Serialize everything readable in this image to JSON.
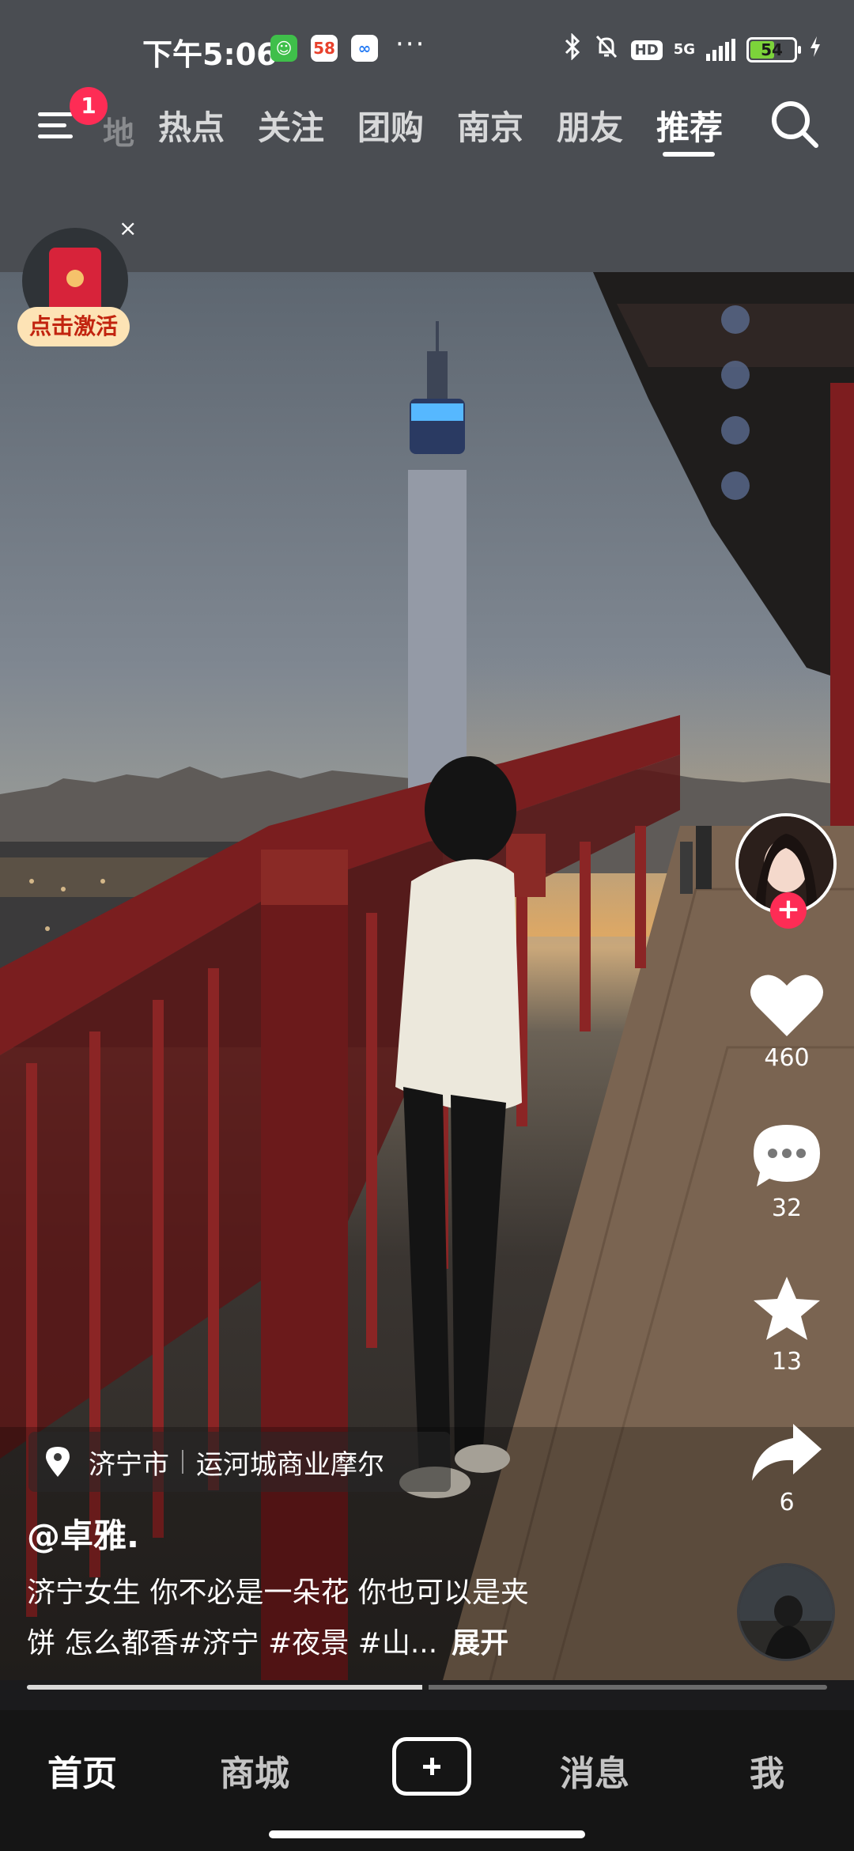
{
  "status_bar": {
    "time": "下午5:06",
    "app_icon_58": "58",
    "more": "···",
    "network": "5G",
    "hd": "HD",
    "battery": "54",
    "battery_level": 0.54,
    "icons": [
      "wechat-icon",
      "app-58-icon",
      "baidu-netdisk-icon",
      "bluetooth-icon",
      "mute-bell-icon",
      "signal-icon",
      "battery-icon",
      "charging-icon"
    ]
  },
  "top_nav": {
    "badge": "1",
    "faded_tab": "地",
    "tabs": [
      "热点",
      "关注",
      "团购",
      "南京",
      "朋友",
      "推荐"
    ],
    "active_tab": "推荐"
  },
  "promo": {
    "label": "点击激活",
    "close": "×"
  },
  "actions": {
    "likes": "460",
    "comments": "32",
    "favorites": "13",
    "shares": "6"
  },
  "location": {
    "city": "济宁市",
    "place": "运河城商业摩尔"
  },
  "post": {
    "author": "@卓雅.",
    "caption_line1": "济宁女生 你不必是一朵花 你也可以是夹",
    "caption_line2": "饼 怎么都香#济宁 #夜景 #山...",
    "expand": "展开",
    "progress": 0.5
  },
  "bottom_nav": {
    "items": [
      "首页",
      "商城",
      "消息",
      "我"
    ],
    "active": "首页"
  },
  "colors": {
    "accent": "#fe2c55",
    "top_bg": "#4a4d52",
    "bottom_bg": "#151515"
  }
}
